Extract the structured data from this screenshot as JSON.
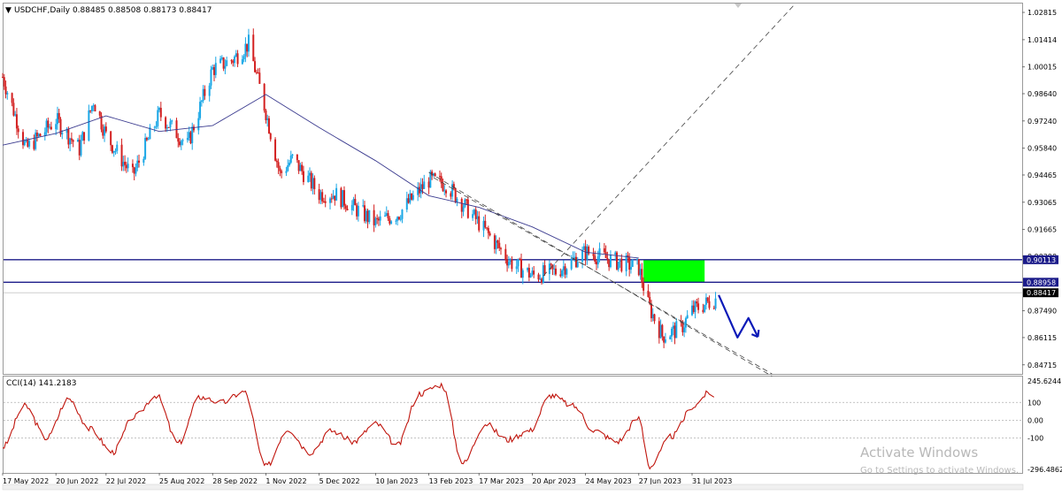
{
  "symbol_header": {
    "menu_glyph": "▼",
    "text": "USDCHF,Daily  0.88485 0.88508 0.88173 0.88417"
  },
  "cci_header": "CCI(14) 141.2183",
  "watermark": {
    "title": "Activate Windows",
    "subtitle": "Go to Settings to activate Windows."
  },
  "colors": {
    "bull_candle": "#1aa7e6",
    "bear_candle": "#d32020",
    "moving_average": "#3b3b8f",
    "level_line": "#1c1c8a",
    "supply_zone": "#00ff00",
    "cci_line": "#c0140c",
    "projection_arrow": "#0c1ab8",
    "trendline": "#444444"
  },
  "chart_data": [
    {
      "type": "candlestick",
      "symbol": "USDCHF",
      "timeframe": "Daily",
      "ohlc_last": {
        "open": 0.88485,
        "high": 0.88508,
        "low": 0.88173,
        "close": 0.88417
      },
      "y_ticks": [
        "1.02815",
        "1.01414",
        "1.00015",
        "0.98640",
        "0.97240",
        "0.95840",
        "0.94465",
        "0.93065",
        "0.91665",
        "0.90290",
        "0.88958",
        "0.87490",
        "0.86115",
        "0.84715"
      ],
      "ylim": [
        0.8425,
        1.0327
      ],
      "x_ticks": [
        "17 May 2022",
        "20 Jun 2022",
        "22 Jul 2022",
        "25 Aug 2022",
        "28 Sep 2022",
        "1 Nov 2022",
        "5 Dec 2022",
        "10 Jan 2023",
        "13 Feb 2023",
        "17 Mar 2023",
        "20 Apr 2023",
        "24 May 2023",
        "27 Jun 2023",
        "31 Jul 2023"
      ],
      "close_path": [
        [
          "17 May 2022",
          0.995
        ],
        [
          "1 Jun 2022",
          0.958
        ],
        [
          "20 Jun 2022",
          0.973
        ],
        [
          "5 Jul 2022",
          0.958
        ],
        [
          "14 Jul 2022",
          0.983
        ],
        [
          "22 Jul 2022",
          0.965
        ],
        [
          "8 Aug 2022",
          0.944
        ],
        [
          "25 Aug 2022",
          0.976
        ],
        [
          "12 Sep 2022",
          0.96
        ],
        [
          "28 Sep 2022",
          0.999
        ],
        [
          "11 Oct 2022",
          1.004
        ],
        [
          "21 Oct 2022",
          1.012
        ],
        [
          "1 Nov 2022",
          0.977
        ],
        [
          "10 Nov 2022",
          0.945
        ],
        [
          "18 Nov 2022",
          0.953
        ],
        [
          "5 Dec 2022",
          0.935
        ],
        [
          "15 Dec 2022",
          0.935
        ],
        [
          "10 Jan 2023",
          0.92
        ],
        [
          "25 Jan 2023",
          0.925
        ],
        [
          "13 Feb 2023",
          0.942
        ],
        [
          "24 Feb 2023",
          0.94
        ],
        [
          "17 Mar 2023",
          0.92
        ],
        [
          "6 Apr 2023",
          0.9
        ],
        [
          "20 Apr 2023",
          0.893
        ],
        [
          "5 May 2023",
          0.895
        ],
        [
          "24 May 2023",
          0.905
        ],
        [
          "14 Jun 2023",
          0.9
        ],
        [
          "27 Jun 2023",
          0.897
        ],
        [
          "3 Jul 2023",
          0.878
        ],
        [
          "12 Jul 2023",
          0.862
        ],
        [
          "24 Jul 2023",
          0.866
        ],
        [
          "31 Jul 2023",
          0.875
        ],
        [
          "15 Aug 2023",
          0.881
        ]
      ],
      "moving_average_path": [
        [
          "17 May 2022",
          0.96
        ],
        [
          "20 Jun 2022",
          0.966
        ],
        [
          "22 Jul 2022",
          0.975
        ],
        [
          "25 Aug 2022",
          0.967
        ],
        [
          "28 Sep 2022",
          0.97
        ],
        [
          "1 Nov 2022",
          0.986
        ],
        [
          "5 Dec 2022",
          0.969
        ],
        [
          "10 Jan 2023",
          0.952
        ],
        [
          "13 Feb 2023",
          0.934
        ],
        [
          "17 Mar 2023",
          0.928
        ],
        [
          "20 Apr 2023",
          0.918
        ],
        [
          "24 May 2023",
          0.905
        ],
        [
          "27 Jun 2023",
          0.902
        ]
      ],
      "horizontal_levels": [
        {
          "value": 0.90113,
          "label": "0.90113"
        },
        {
          "value": 0.88958,
          "label": "0.88958"
        }
      ],
      "current_price": {
        "value": 0.88417,
        "label": "0.88417"
      },
      "supply_zone": {
        "x_from": "30 Jun 2023",
        "x_to": "8 Aug 2023",
        "y_from": 0.88958,
        "y_to": 0.90113
      },
      "trendlines": [
        {
          "style": "dashed",
          "from": [
            "13 Feb 2023",
            0.946
          ],
          "to": [
            "20 Sep 2023",
            0.8413
          ]
        },
        {
          "style": "dashed",
          "from": [
            "16 Feb 2023",
            0.9433
          ],
          "to": [
            "20 Sep 2023",
            0.8425
          ]
        },
        {
          "style": "dashed",
          "from": [
            "27 Apr 2023",
            0.8928
          ],
          "to": [
            "5 Oct 2023",
            1.0327
          ]
        }
      ],
      "projection_path": [
        [
          "17 Aug 2023",
          0.883
        ],
        [
          "29 Aug 2023",
          0.8612
        ],
        [
          "5 Sep 2023",
          0.8712
        ],
        [
          "11 Sep 2023",
          0.8615
        ]
      ]
    },
    {
      "type": "line",
      "indicator": "CCI(14)",
      "current_value": 141.2183,
      "y_ticks": [
        "245.6244",
        "100",
        "0.00",
        "-100",
        "-296.4862"
      ],
      "ylim": [
        -296.4862,
        245.6244
      ],
      "levels": [
        100,
        0,
        -100
      ],
      "values": [
        [
          "17 May 2022",
          -150
        ],
        [
          "31 May 2022",
          80
        ],
        [
          "14 Jun 2022",
          -100
        ],
        [
          "28 Jun 2022",
          120
        ],
        [
          "12 Jul 2022",
          -50
        ],
        [
          "26 Jul 2022",
          -180
        ],
        [
          "9 Aug 2022",
          20
        ],
        [
          "23 Aug 2022",
          140
        ],
        [
          "6 Sep 2022",
          -130
        ],
        [
          "20 Sep 2022",
          130
        ],
        [
          "4 Oct 2022",
          100
        ],
        [
          "18 Oct 2022",
          160
        ],
        [
          "1 Nov 2022",
          -260
        ],
        [
          "15 Nov 2022",
          -50
        ],
        [
          "29 Nov 2022",
          -180
        ],
        [
          "13 Dec 2022",
          -60
        ],
        [
          "27 Dec 2022",
          -120
        ],
        [
          "10 Jan 2023",
          -20
        ],
        [
          "24 Jan 2023",
          -140
        ],
        [
          "7 Feb 2023",
          150
        ],
        [
          "21 Feb 2023",
          200
        ],
        [
          "7 Mar 2023",
          -240
        ],
        [
          "21 Mar 2023",
          -20
        ],
        [
          "4 Apr 2023",
          -110
        ],
        [
          "18 Apr 2023",
          -60
        ],
        [
          "2 May 2023",
          140
        ],
        [
          "16 May 2023",
          80
        ],
        [
          "30 May 2023",
          -60
        ],
        [
          "13 Jun 2023",
          -120
        ],
        [
          "27 Jun 2023",
          10
        ],
        [
          "4 Jul 2023",
          -260
        ],
        [
          "18 Jul 2023",
          -90
        ],
        [
          "1 Aug 2023",
          80
        ],
        [
          "10 Aug 2023",
          150
        ],
        [
          "14 Aug 2023",
          141.2183
        ]
      ]
    }
  ]
}
